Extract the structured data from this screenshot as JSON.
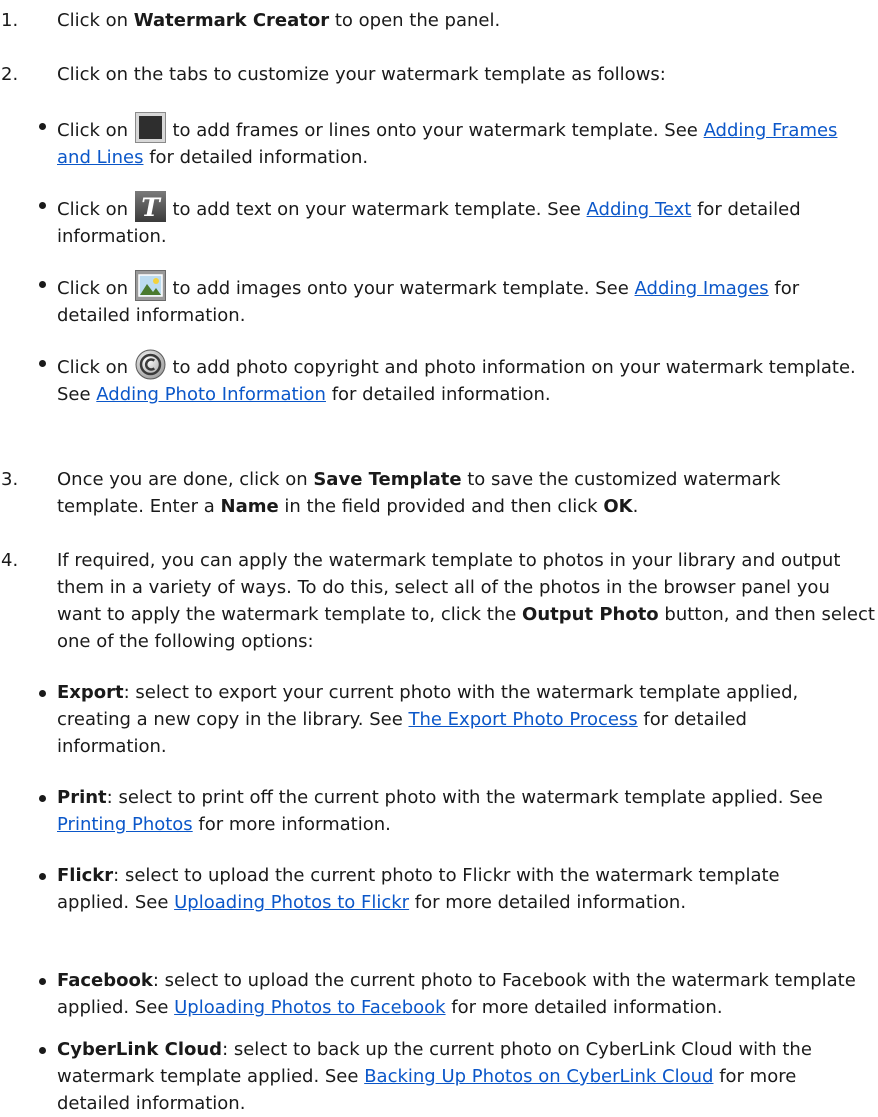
{
  "steps": [
    {
      "number": "1.",
      "pre": "Click on ",
      "bold": "Watermark Creator",
      "post": " to open the panel."
    },
    {
      "number": "2.",
      "text": "Click on the tabs to customize your watermark template as follows:"
    },
    {
      "number": "3.",
      "t1": "Once you are done, click on ",
      "b1": "Save Template",
      "t2": " to save the customized watermark template. Enter a ",
      "b2": "Name",
      "t3": " in the field provided and then click ",
      "b3": "OK",
      "t4": "."
    },
    {
      "number": "4.",
      "t1": "If required, you can apply the watermark template to photos in your library and output them in a variety of ways. To do this, select all of the photos in the browser panel you want to apply the watermark template to, click the ",
      "b1": "Output Photo",
      "t2": " button, and then select one of the following options:"
    }
  ],
  "tab_bullets": [
    {
      "icon": "frame-tab-icon",
      "pre": "Click on ",
      "post": " to add frames or lines onto your watermark template. See ",
      "link": "Adding Frames and Lines",
      "tail": " for detailed information."
    },
    {
      "icon": "text-tab-icon",
      "icon_letter": "T",
      "pre": "Click on ",
      "post": " to add text on your watermark template. See ",
      "link": "Adding Text",
      "tail": " for detailed information."
    },
    {
      "icon": "image-tab-icon",
      "pre": "Click on ",
      "post": " to add images onto your watermark template. See ",
      "link": "Adding Images",
      "tail": " for detailed information."
    },
    {
      "icon": "copyright-tab-icon",
      "pre": "Click on ",
      "post": " to add photo copyright and photo information on your watermark template. See ",
      "link": "Adding Photo Information",
      "tail": " for detailed information."
    }
  ],
  "output_bullets": [
    {
      "bold": "Export",
      "text": ": select to export your current photo with the watermark template applied, creating a new copy in the library. See ",
      "link": "The Export Photo Process",
      "tail": " for detailed information."
    },
    {
      "bold": "Print",
      "text": ": select to print off the current photo with the watermark template applied. See ",
      "link": "Printing Photos",
      "tail": " for more information."
    },
    {
      "bold": "Flickr",
      "text": ": select to upload the current photo to Flickr with the watermark template applied. See ",
      "link": "Uploading Photos to Flickr",
      "tail": " for more detailed information."
    },
    {
      "bold": "Facebook",
      "text": ": select to upload the current photo to Facebook with the watermark template applied. See ",
      "link": "Uploading Photos to Facebook",
      "tail": " for more detailed information."
    },
    {
      "bold": "CyberLink Cloud",
      "text": ": select to back up the current photo on CyberLink Cloud with the watermark template applied. See ",
      "link": "Backing Up Photos on CyberLink Cloud",
      "tail": " for more detailed information."
    }
  ],
  "colors": {
    "link": "#0b57c9",
    "text": "#1a1a1a"
  }
}
